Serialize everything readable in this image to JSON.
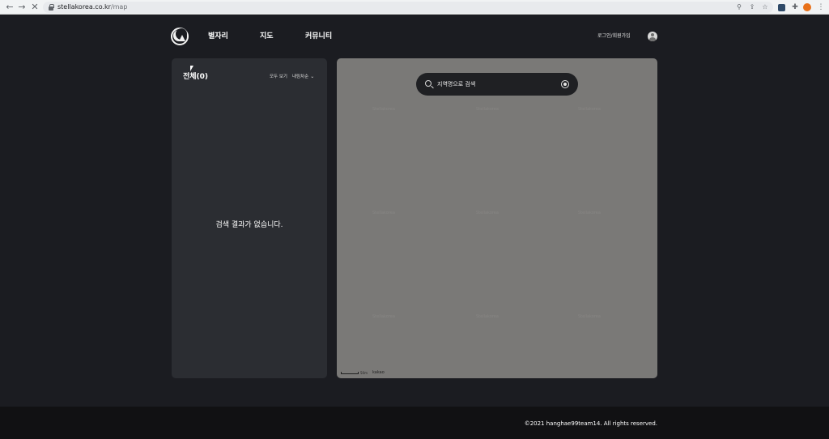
{
  "browser": {
    "url_host": "stellakorea.co.kr",
    "url_path": "/map",
    "back_icon": "←",
    "forward_icon": "→",
    "stop_icon": "✕",
    "location_icon": "⚲",
    "share_icon": "⇪",
    "star_icon": "☆",
    "puzzle_icon": "✚",
    "menu_icon": "⋮"
  },
  "header": {
    "nav": [
      "별자리",
      "지도",
      "커뮤니티"
    ],
    "login_label": "로그인/회원가입"
  },
  "list_panel": {
    "title": "전체(0)",
    "view_all_label": "모두 보기",
    "sort_label": "내림차순",
    "sort_chevron": "⌄",
    "empty_message": "검색 결과가 없습니다."
  },
  "map": {
    "search_placeholder": "지역명으로 검색",
    "tile_watermark": "Stellakorea",
    "scale_text": "50m",
    "attribution": "kakao"
  },
  "footer": {
    "copyright": "©2021 hanghae99team14. All rights reserved."
  },
  "colors": {
    "background": "#1b1c21",
    "panel": "#2b2d32",
    "map": "#7a7977",
    "footer": "#111113"
  }
}
